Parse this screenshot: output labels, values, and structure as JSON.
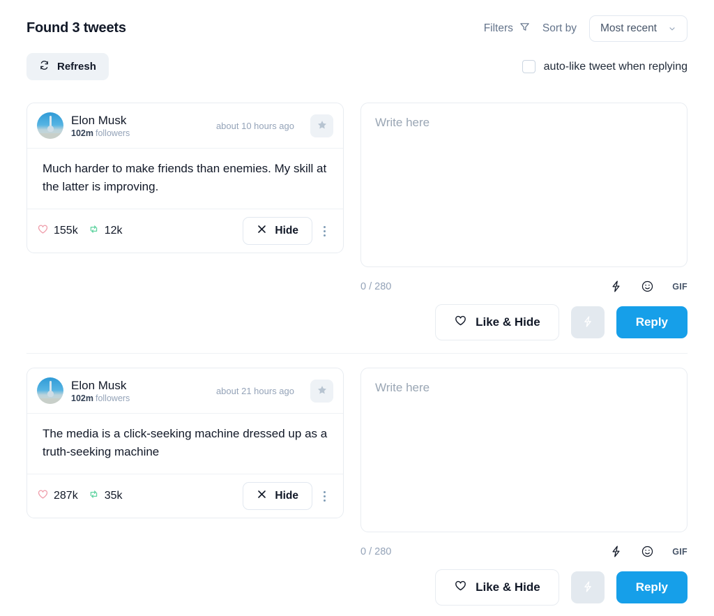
{
  "header": {
    "title": "Found 3 tweets",
    "filters_label": "Filters",
    "filters_icon": "funnel-icon",
    "sort_by_label": "Sort by",
    "sort_value": "Most recent",
    "sort_chevron_icon": "chevron-down-icon",
    "refresh_label": "Refresh",
    "refresh_icon": "refresh-icon",
    "autolike_label": "auto-like tweet when replying",
    "autolike_checked": false
  },
  "colors": {
    "accent_blue": "#169fe9",
    "heart_pink": "#ef9aa8",
    "retweet_green": "#5fd3a0",
    "muted_text": "#94a3b8",
    "card_border": "#e8ecf1",
    "chip_bg": "#eef2f6"
  },
  "composer": {
    "placeholder": "Write here",
    "value": "",
    "counter": "0 / 280",
    "bolt_icon": "lightning-icon",
    "emoji_icon": "emoji-smiley-icon",
    "gif_label": "GIF",
    "like_hide_label": "Like & Hide",
    "like_hide_icon": "heart-outline-icon",
    "boost_icon": "lightning-icon",
    "reply_label": "Reply"
  },
  "tweets": [
    {
      "author": "Elon Musk",
      "followers_count": "102m",
      "followers_label": "followers",
      "timestamp": "about 10 hours ago",
      "avatar_icon": "rocket-avatar",
      "star_icon": "star-icon",
      "text": "Much harder to make friends than enemies. My skill at the latter is improving.",
      "likes": "155k",
      "retweets": "12k",
      "like_icon": "heart-outline-icon",
      "retweet_icon": "retweet-icon",
      "hide_label": "Hide",
      "hide_icon": "close-x-icon",
      "menu_icon": "kebab-menu-icon"
    },
    {
      "author": "Elon Musk",
      "followers_count": "102m",
      "followers_label": "followers",
      "timestamp": "about 21 hours ago",
      "avatar_icon": "rocket-avatar",
      "star_icon": "star-icon",
      "text": "The media is a click-seeking machine dressed up as a truth-seeking machine",
      "likes": "287k",
      "retweets": "35k",
      "like_icon": "heart-outline-icon",
      "retweet_icon": "retweet-icon",
      "hide_label": "Hide",
      "hide_icon": "close-x-icon",
      "menu_icon": "kebab-menu-icon"
    }
  ]
}
